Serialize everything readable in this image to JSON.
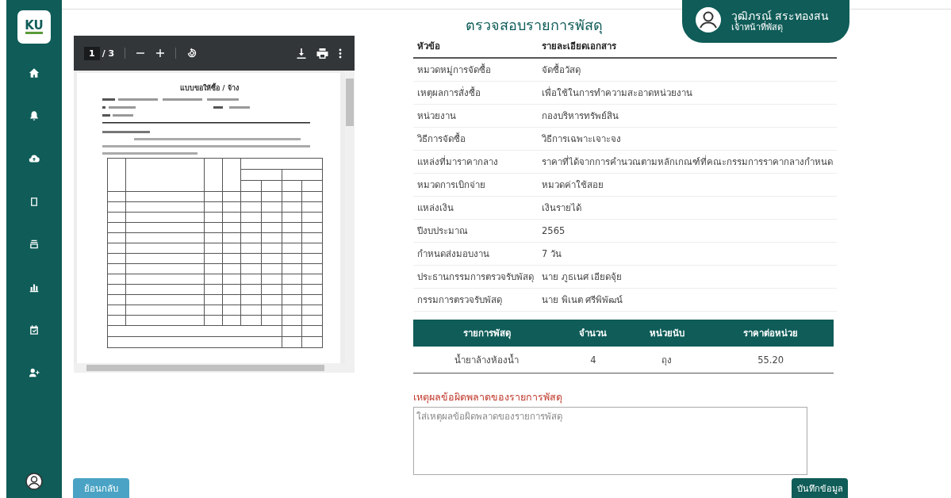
{
  "logo": {
    "text": "KU"
  },
  "page_title": "ตรวจสอบรายการพัสดุ",
  "user": {
    "name": "วุฒิภรณ์ สระทองสน",
    "role": "เจ้าหน้าที่พัสดุ"
  },
  "pdf_viewer": {
    "page": "1",
    "total": "/ 3",
    "document": {
      "title": "แบบขอให้ซื้อ / จ้าง"
    }
  },
  "details": {
    "columns": [
      "หัวข้อ",
      "รายละเอียดเอกสาร"
    ],
    "rows": [
      {
        "label": "หมวดหมู่การจัดซื้อ",
        "value": "จัดซื้อวัสดุ"
      },
      {
        "label": "เหตุผลการสั่งซื้อ",
        "value": "เพื่อใช้ในการทำความสะอาดหน่วยงาน"
      },
      {
        "label": "หน่วยงาน",
        "value": "กองบริหารทรัพย์สิน"
      },
      {
        "label": "วิธีการจัดซื้อ",
        "value": "วิธีการเฉพาะเจาะจง"
      },
      {
        "label": "แหล่งที่มาราคากลาง",
        "value": "ราคาที่ได้จากการคำนวณตามหลักเกณฑ์ที่คณะกรรมการราคากลางกำหนด"
      },
      {
        "label": "หมวดการเบิกจ่าย",
        "value": "หมวดค่าใช้สอย"
      },
      {
        "label": "แหล่งเงิน",
        "value": "เงินรายได้"
      },
      {
        "label": "ปีงบประมาณ",
        "value": "2565"
      },
      {
        "label": "กำหนดส่งมอบงาน",
        "value": "7 วัน"
      },
      {
        "label": "ประธานกรรมการตรวจรับพัสดุ",
        "value": "นาย ภูธเนศ เอียดจุ้ย"
      },
      {
        "label": "กรรมการตรวจรับพัสดุ",
        "value": "นาย พิเนต ศรีพิพัฒน์"
      }
    ]
  },
  "items": {
    "columns": [
      "รายการพัสดุ",
      "จำนวน",
      "หน่วยนับ",
      "ราคาต่อหน่วย"
    ],
    "rows": [
      [
        "น้ำยาล้างห้องน้ำ",
        "4",
        "ถุง",
        "55.20"
      ]
    ]
  },
  "reason": {
    "label": "เหตุผลข้อผิดพลาดของรายการพัสดุ",
    "placeholder": "ใส่เหตุผลข้อผิดพลาดของรายการพัสดุ"
  },
  "buttons": {
    "back": "ย้อนกลับ",
    "save": "บันทึกข้อมูล"
  }
}
